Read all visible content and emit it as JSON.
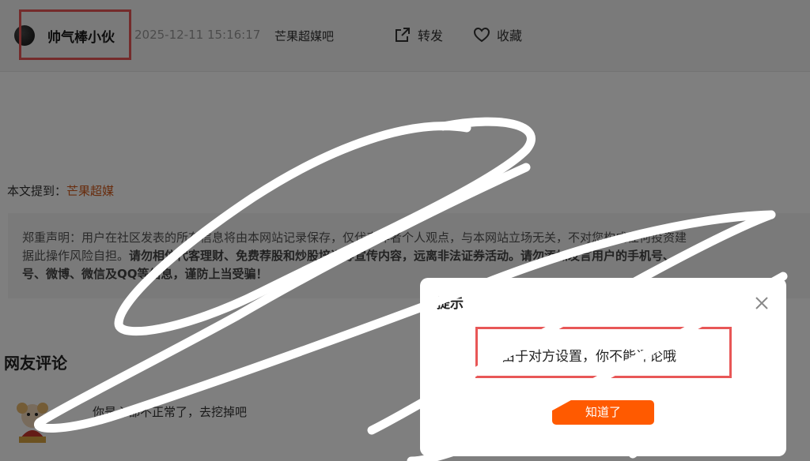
{
  "header": {
    "username": "帅气棒小伙",
    "timestamp": "2025-12-11 15:16:17",
    "topic": "芒果超媒吧",
    "share_label": "转发",
    "favorite_label": "收藏"
  },
  "article": {
    "mention_prefix": "本文提到：",
    "mention_tag": "芒果超媒"
  },
  "disclaimer": {
    "line1": "郑重声明：用户在社区发表的所有信息将由本网站记录保存，仅代表作者个人观点，与本网站立场无关，不对您构成任何投资建",
    "line2_plain": "据此操作风险自担。",
    "line2_bold": "请勿相信代客理财、免费荐股和炒股培训等宣传内容，远离非法证券活动。请勿添加发言用户的手机号、",
    "line3_bold": "号、微博、微信及QQ等信息，谨防上当受骗！"
  },
  "comments": {
    "title": "网友评论",
    "items": [
      {
        "text": "你是心都不正常了，去挖掉吧"
      }
    ]
  },
  "dialog": {
    "title": "提示",
    "message": "由于对方设置，你不能评论哦",
    "button_label": "知道了"
  },
  "colors": {
    "accent": "#ff5a00",
    "highlight_box": "#e85757",
    "tag": "#d0581a"
  },
  "icons": {
    "share": "share-icon",
    "favorite": "heart-icon",
    "close": "close-icon"
  }
}
